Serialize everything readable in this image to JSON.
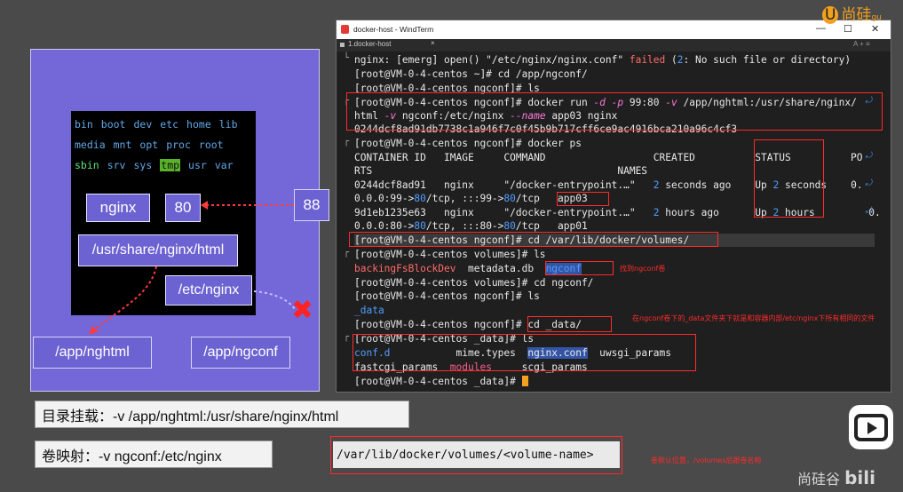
{
  "brand": {
    "top_logo": "尚硅",
    "top_logo_suffix": "gu",
    "bottom_logo": "尚硅谷",
    "bottom_logo_suffix": "bili"
  },
  "diagram": {
    "dirs_row1": [
      "bin",
      "boot",
      "dev",
      "etc",
      "home",
      "lib"
    ],
    "dirs_row2": [
      "media",
      "mnt",
      "opt",
      "proc",
      "root"
    ],
    "dirs_row3": [
      "sbin",
      "srv",
      "sys",
      "tmp",
      "usr",
      "var"
    ],
    "nginx_label": "nginx",
    "port_label": "80",
    "host_port": "88",
    "html_path": "/usr/share/nginx/html",
    "conf_path": "/etc/nginx",
    "host_html": "/app/nghtml",
    "host_conf": "/app/ngconf",
    "x_mark": "✖"
  },
  "captions": {
    "dir_mount": "目录挂载：-v /app/nghtml:/usr/share/nginx/html",
    "volume_mount": "卷映射：-v ngconf:/etc/nginx",
    "volume_path": "/var/lib/docker/volumes/<volume-name>",
    "volume_path_note": "卷默认位置，/volumes后跟卷名称"
  },
  "window": {
    "title": "docker-host - WindTerm",
    "tab": "1.docker-host",
    "tab_close": "×",
    "tab_right": "A  +  ≡",
    "controls": [
      "—",
      "☐",
      "✕"
    ]
  },
  "terminal": {
    "l1a": "nginx: [emerg] open() \"/etc/nginx/nginx.conf\" ",
    "l1b": "failed",
    "l1c": " (",
    "l1d": "2",
    "l1e": ": No such file or directory)",
    "l2": "[root@VM-0-4-centos ~]# cd /app/ngconf/",
    "l3": "[root@VM-0-4-centos ngconf]# ls",
    "l4a": "[root@VM-0-4-centos ngconf]# docker run ",
    "l4b": "-d -p",
    "l4c": " 99:80 ",
    "l4d": "-v",
    "l4e": " /app/nghtml:/usr/share/nginx/",
    "l5a": "html ",
    "l5b": "-v",
    "l5c": " ngconf:/etc/nginx ",
    "l5d": "--name",
    "l5e": " app03 nginx",
    "l6": "0244dcf8ad91db7738c1a946f7c0f45b9b717cff6ce9ac4916bca210a96c4cf3",
    "l7": "[root@VM-0-4-centos ngconf]# docker ps",
    "l8": "CONTAINER ID   IMAGE     COMMAND                  CREATED          STATUS          PO",
    "l9": "RTS                                         NAMES",
    "l10a": "0244dcf8ad91   nginx     \"/docker-entrypoint.…\"   ",
    "l10b": "2",
    "l10c": " seconds ago    Up ",
    "l10d": "2",
    "l10e": " seconds    0.",
    "l11a": "0.0.0:99->",
    "l11b": "80",
    "l11c": "/tcp, :::99->",
    "l11d": "80",
    "l11e": "/tcp   app03",
    "l12a": "9d1eb1235e63   nginx     \"/docker-entrypoint.…\"   ",
    "l12b": "2",
    "l12c": " hours ago      Up ",
    "l12d": "2",
    "l12e": " hours         0.",
    "l13a": "0.0.0:80->",
    "l13b": "80",
    "l13c": "/tcp, :::80->",
    "l13d": "80",
    "l13e": "/tcp   app01",
    "l14": "[root@VM-0-4-centos ngconf]# cd /var/lib/docker/volumes/",
    "l15": "[root@VM-0-4-centos volumes]# ls",
    "l16a": "backingFsBlockDev",
    "l16b": "  metadata.db  ",
    "l16c": "ngconf",
    "l17": "[root@VM-0-4-centos volumes]# cd ngconf/",
    "l18": "[root@VM-0-4-centos ngconf]# ls",
    "l19": "_data",
    "l20": "[root@VM-0-4-centos ngconf]# cd _data/",
    "l21": "[root@VM-0-4-centos _data]# ls",
    "l22a": "conf.d",
    "l22b": "           mime.types  ",
    "l22c": "nginx.conf",
    "l22d": "  uwsgi_params",
    "l23a": "fastcgi_params  ",
    "l23b": "modules",
    "l23c": "     scgi_params",
    "l24": "[root@VM-0-4-centos _data]# ",
    "note_found": "找到ngconf卷",
    "note_data": "在ngconf卷下的_data文件夹下就是和容器内部/etc/nginx下所有相同的文件"
  }
}
